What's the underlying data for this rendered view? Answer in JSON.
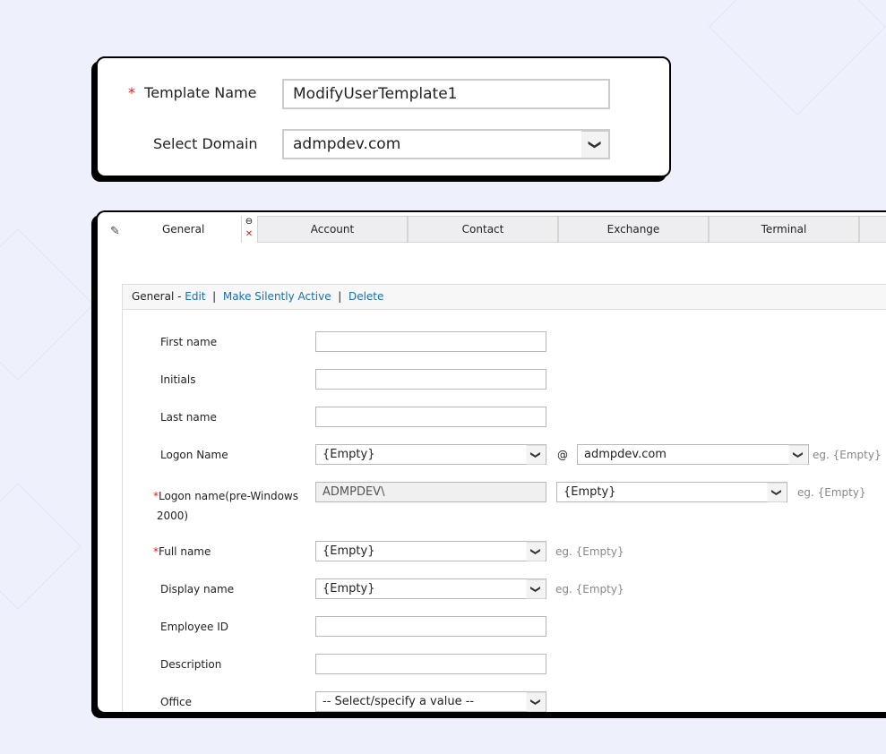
{
  "template": {
    "name_label": "Template Name",
    "name_value": "ModifyUserTemplate1",
    "domain_label": "Select Domain",
    "domain_value": "admpdev.com"
  },
  "tabs": [
    {
      "label": "General"
    },
    {
      "label": "Account"
    },
    {
      "label": "Contact"
    },
    {
      "label": "Exchange"
    },
    {
      "label": "Terminal"
    }
  ],
  "section": {
    "title": "General -",
    "edit": "Edit",
    "sep": "|",
    "silent": "Make Silently Active",
    "delete": "Delete"
  },
  "fields": {
    "first_name": "First name",
    "initials": "Initials",
    "last_name": "Last name",
    "logon_name": "Logon Name",
    "logon_value": "{Empty}",
    "at": "@",
    "logon_domain": "admpdev.com",
    "logon_eg": "eg. {Empty}",
    "pre2000": "Logon name(pre-Windows",
    "pre2000_b": "2000)",
    "pre2000_prefix": "ADMPDEV\\",
    "pre2000_value": "{Empty}",
    "pre2000_eg": "eg. {Empty}",
    "full_name": "Full name",
    "full_value": "{Empty}",
    "full_eg": "eg. {Empty}",
    "display_name": "Display name",
    "display_value": "{Empty}",
    "display_eg": "eg. {Empty}",
    "employee_id": "Employee ID",
    "description": "Description",
    "office": "Office",
    "office_value": "-- Select/specify a value --"
  },
  "colors": {
    "accent": "#1a6fb0",
    "required": "#e02020",
    "background": "#eef0fc"
  }
}
